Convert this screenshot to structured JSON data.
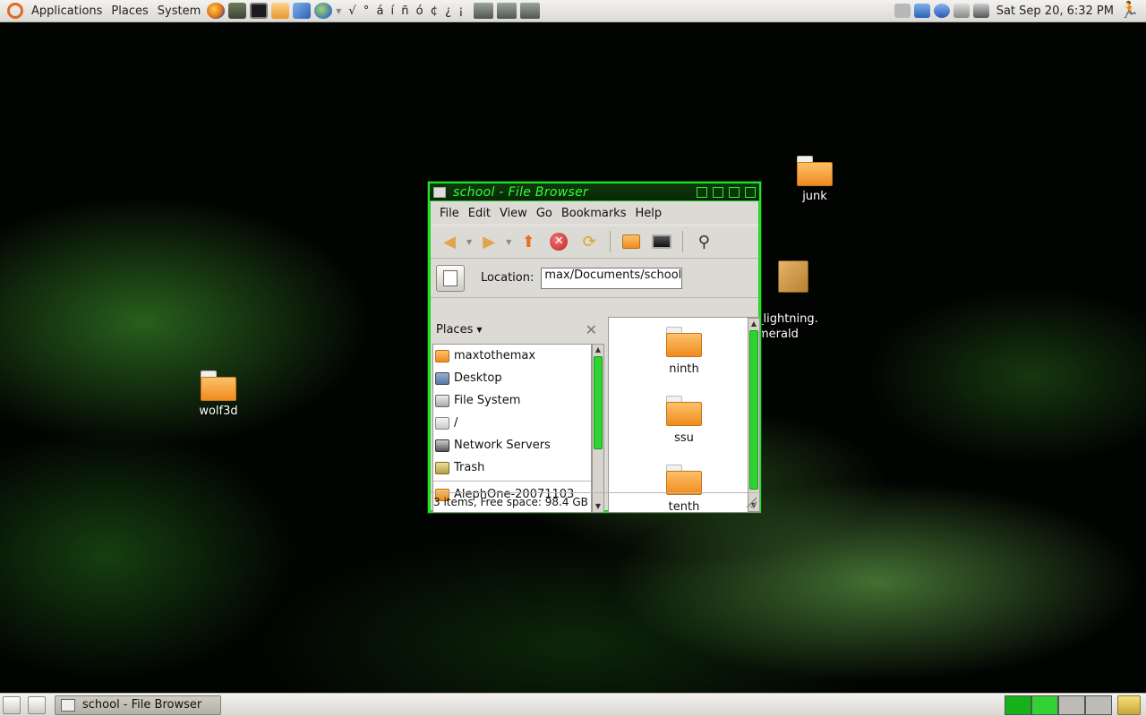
{
  "top_panel": {
    "menus": [
      "Applications",
      "Places",
      "System"
    ],
    "chars": "√ ° á í ñ ó ¢ ¿ ¡",
    "clock": "Sat Sep 20,  6:32 PM"
  },
  "desktop": {
    "icons": [
      {
        "label": "junk"
      },
      {
        "label": "_lightning.\nmerald"
      },
      {
        "label": "wolf3d"
      }
    ]
  },
  "window": {
    "title": "school - File Browser",
    "menu": [
      "File",
      "Edit",
      "View",
      "Go",
      "Bookmarks",
      "Help"
    ],
    "location_label": "Location:",
    "location_value": "max/Documents/school",
    "places_header": "Places",
    "places": [
      {
        "label": "maxtothemax",
        "icon": "home-folder-icon"
      },
      {
        "label": "Desktop",
        "icon": "desktop-icon"
      },
      {
        "label": "File System",
        "icon": "drive-icon"
      },
      {
        "label": "/",
        "icon": "drive-icon"
      },
      {
        "label": "Network Servers",
        "icon": "network-icon"
      },
      {
        "label": "Trash",
        "icon": "trash-icon"
      }
    ],
    "bookmarks": [
      {
        "label": "AlephOne-20071103",
        "icon": "folder-icon"
      }
    ],
    "files": [
      "ninth",
      "ssu",
      "tenth"
    ],
    "status": "3 items, Free space: 98.4 GB"
  },
  "bottom_panel": {
    "task": "school - File Browser"
  },
  "colors": {
    "window_border": "#22e52a",
    "title_text": "#35ff35",
    "scrollbar_thumb": "#2fd32f"
  }
}
